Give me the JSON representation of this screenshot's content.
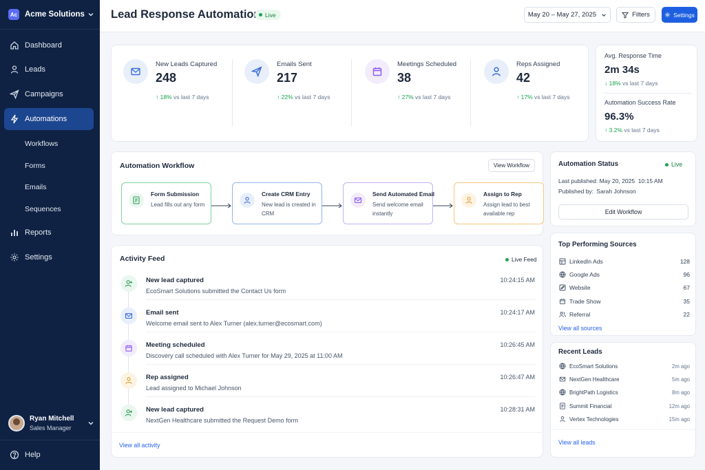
{
  "brand": {
    "logo_text": "Ac",
    "name": "Acme Solutions"
  },
  "nav": {
    "items": [
      {
        "label": "Dashboard",
        "icon": "home-icon"
      },
      {
        "label": "Leads",
        "icon": "user-icon"
      },
      {
        "label": "Campaigns",
        "icon": "send-icon"
      },
      {
        "label": "Automations",
        "icon": "bolt-icon",
        "active": true
      },
      {
        "label": "Reports",
        "icon": "bar-chart-icon"
      },
      {
        "label": "Settings",
        "icon": "gear-icon"
      }
    ],
    "sub_items": [
      "Workflows",
      "Forms",
      "Emails",
      "Sequences"
    ],
    "help": "Help"
  },
  "user": {
    "name": "Ryan Mitchell",
    "role": "Sales Manager"
  },
  "header": {
    "title": "Lead Response Automation",
    "status": "Live",
    "date_range": "May 20 – May 27, 2025",
    "filters_label": "Filters",
    "settings_label": "Settings"
  },
  "kpis": [
    {
      "label": "New Leads Captured",
      "value": "248",
      "change": "18%",
      "compare": "vs last 7 days",
      "icon": "mail-icon",
      "color": "#3b6fd8",
      "bg": "#e8effb"
    },
    {
      "label": "Emails Sent",
      "value": "217",
      "change": "22%",
      "compare": "vs last 7 days",
      "icon": "send-icon",
      "color": "#3b6fd8",
      "bg": "#e8effb"
    },
    {
      "label": "Meetings Scheduled",
      "value": "38",
      "change": "27%",
      "compare": "vs last 7 days",
      "icon": "calendar-icon",
      "color": "#8b5cf6",
      "bg": "#f2ecfd"
    },
    {
      "label": "Reps Assigned",
      "value": "42",
      "change": "17%",
      "compare": "vs last 7 days",
      "icon": "user-icon",
      "color": "#3b6fd8",
      "bg": "#e8effb"
    }
  ],
  "side_kpis": [
    {
      "label": "Avg. Response Time",
      "value": "2m 34s",
      "change": "18%",
      "compare": "vs last 7 days"
    },
    {
      "label": "Automation Success Rate",
      "value": "96.3%",
      "change": "3.2%",
      "compare": "vs last 7 days"
    }
  ],
  "workflow": {
    "title": "Automation Workflow",
    "view_label": "View Workflow",
    "steps": [
      {
        "title": "Form Submission",
        "desc": "Lead fills out any form",
        "icon": "form-icon",
        "color": "#2f9e5a",
        "bg": "#eaf7ef",
        "border": "#7dd3a0"
      },
      {
        "title": "Create CRM Entry",
        "desc": "New lead is created in CRM",
        "icon": "user-icon",
        "color": "#3b6fd8",
        "bg": "#e8effb",
        "border": "#93b4ef"
      },
      {
        "title": "Send Automated Email",
        "desc": "Send welcome email instantly",
        "icon": "mail-icon",
        "color": "#8b5cf6",
        "bg": "#f2ecfd",
        "border": "#c4b1f5"
      },
      {
        "title": "Assign to Rep",
        "desc": "Assign lead to best available rep",
        "icon": "user-icon",
        "color": "#e39b2b",
        "bg": "#fdf3e3",
        "border": "#f5c97b"
      }
    ]
  },
  "activity": {
    "title": "Activity Feed",
    "live_label": "Live Feed",
    "view_all": "View all activity",
    "items": [
      {
        "title": "New lead captured",
        "desc": "EcoSmart Solutions submitted the Contact Us form",
        "time": "10:24:15 AM",
        "icon": "user-plus-icon",
        "color": "#2f9e5a",
        "bg": "#eaf7ef"
      },
      {
        "title": "Email sent",
        "desc": "Welcome email sent to Alex Turner (alex.turner@ecosmart.com)",
        "time": "10:24:17 AM",
        "icon": "mail-icon",
        "color": "#3b6fd8",
        "bg": "#e8effb"
      },
      {
        "title": "Meeting scheduled",
        "desc": "Discovery call scheduled with Alex Turner for May 29, 2025 at 11:00 AM",
        "time": "10:26:45 AM",
        "icon": "calendar-icon",
        "color": "#8b5cf6",
        "bg": "#f2ecfd"
      },
      {
        "title": "Rep assigned",
        "desc": "Lead assigned to Michael Johnson",
        "time": "10:26:47 AM",
        "icon": "user-icon",
        "color": "#e39b2b",
        "bg": "#fdf3e3"
      },
      {
        "title": "New lead captured",
        "desc": "NextGen Healthcare submitted the Request Demo form",
        "time": "10:28:31 AM",
        "icon": "user-plus-icon",
        "color": "#2f9e5a",
        "bg": "#eaf7ef"
      }
    ]
  },
  "status": {
    "title": "Automation Status",
    "state": "Live",
    "published_label": "Last published:",
    "published_value": "May 20, 2025  10:15 AM",
    "by_label": "Published by:",
    "by_value": "Sarah Johnson",
    "edit_label": "Edit Workflow"
  },
  "sources": {
    "title": "Top Performing Sources",
    "view_all": "View all sources",
    "items": [
      {
        "name": "LinkedIn Ads",
        "count": "128",
        "icon": "grid-icon"
      },
      {
        "name": "Google Ads",
        "count": "96",
        "icon": "globe-icon"
      },
      {
        "name": "Website",
        "count": "67",
        "icon": "edit-icon"
      },
      {
        "name": "Trade Show",
        "count": "35",
        "icon": "calendar-icon"
      },
      {
        "name": "Referral",
        "count": "22",
        "icon": "users-icon"
      }
    ]
  },
  "recent_leads": {
    "title": "Recent Leads",
    "view_all": "View all leads",
    "items": [
      {
        "name": "EcoSmart Solutions",
        "time": "2m ago",
        "icon": "globe-icon"
      },
      {
        "name": "NextGen Healthcare",
        "time": "5m ago",
        "icon": "mail-icon"
      },
      {
        "name": "BrightPath Logistics",
        "time": "8m ago",
        "icon": "globe-icon"
      },
      {
        "name": "Summit Financial",
        "time": "12m ago",
        "icon": "form-icon"
      },
      {
        "name": "Vertex Technologies",
        "time": "15m ago",
        "icon": "user-icon"
      }
    ]
  }
}
